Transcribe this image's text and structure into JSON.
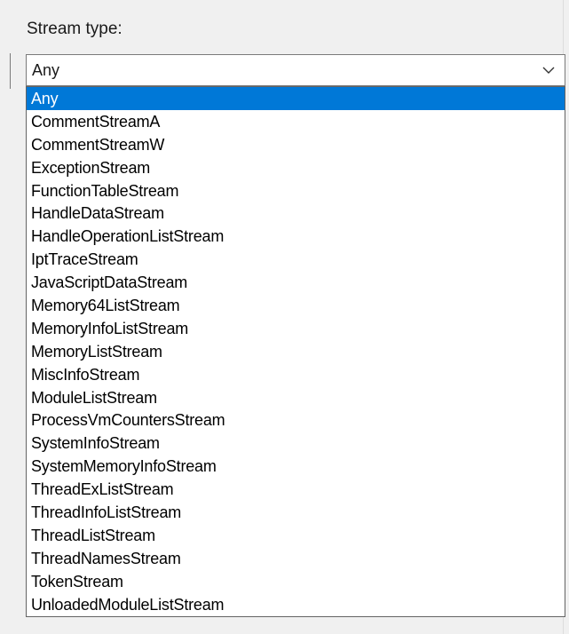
{
  "stream_type": {
    "label": "Stream type:",
    "selected_value": "Any",
    "options": [
      "Any",
      "CommentStreamA",
      "CommentStreamW",
      "ExceptionStream",
      "FunctionTableStream",
      "HandleDataStream",
      "HandleOperationListStream",
      "IptTraceStream",
      "JavaScriptDataStream",
      "Memory64ListStream",
      "MemoryInfoListStream",
      "MemoryListStream",
      "MiscInfoStream",
      "ModuleListStream",
      "ProcessVmCountersStream",
      "SystemInfoStream",
      "SystemMemoryInfoStream",
      "ThreadExListStream",
      "ThreadInfoListStream",
      "ThreadListStream",
      "ThreadNamesStream",
      "TokenStream",
      "UnloadedModuleListStream"
    ],
    "highlighted_index": 0
  },
  "icons": {
    "combo_arrow": "chevron-down-icon"
  },
  "colors": {
    "highlight": "#0078d7",
    "highlight_text": "#ffffff",
    "panel_background": "#f0f0f0"
  }
}
